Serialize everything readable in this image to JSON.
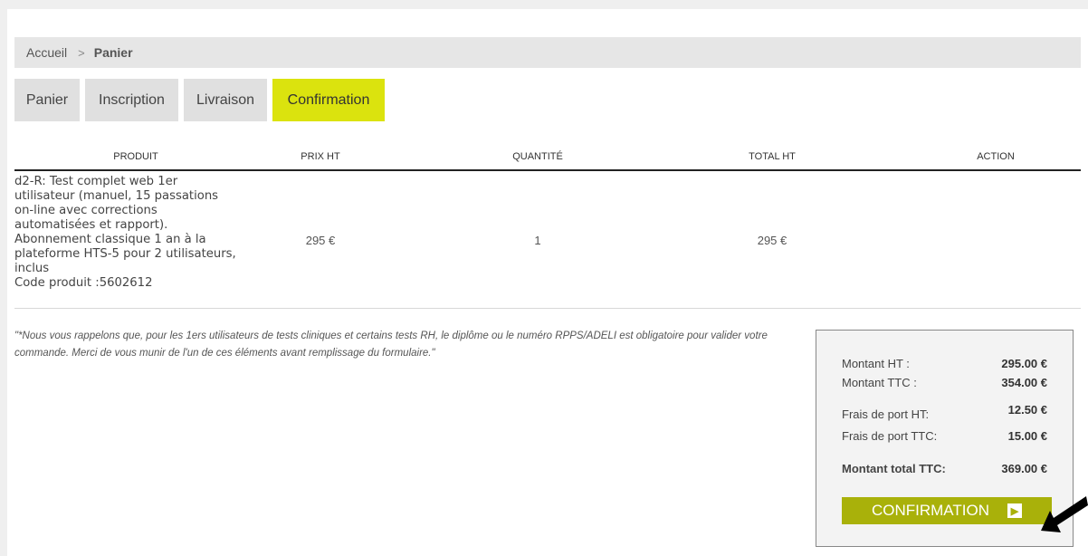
{
  "breadcrumb": {
    "home": "Accueil",
    "separator": ">",
    "current": "Panier"
  },
  "tabs": [
    {
      "label": "Panier",
      "active": false
    },
    {
      "label": "Inscription",
      "active": false
    },
    {
      "label": "Livraison",
      "active": false
    },
    {
      "label": "Confirmation",
      "active": true
    }
  ],
  "table": {
    "headers": {
      "product": "PRODUIT",
      "price": "PRIX HT",
      "quantity": "QUANTITÉ",
      "total": "TOTAL HT",
      "action": "ACTION"
    },
    "rows": [
      {
        "product": "d2-R: Test complet web 1er utilisateur (manuel, 15 passations on-line avec corrections automatisées et rapport). Abonnement classique 1 an à la plateforme HTS-5 pour 2 utilisateurs, inclus",
        "code": "Code produit :5602612",
        "price": "295 €",
        "quantity": "1",
        "total": "295 €"
      }
    ]
  },
  "note": "\"*Nous vous rappelons que, pour les 1ers utilisateurs de tests cliniques et certains tests RH, le diplôme ou le numéro RPPS/ADELI est obligatoire pour valider votre commande. Merci de vous munir de l'un de ces éléments avant remplissage du formulaire.\"",
  "summary": {
    "ht_label": "Montant HT :",
    "ht_value": "295.00 €",
    "ttc_label": "Montant TTC :",
    "ttc_value": "354.00 €",
    "shipping_ht_label": "Frais de port HT:",
    "shipping_ht_value": "12.50 €",
    "shipping_ttc_label": "Frais de port TTC:",
    "shipping_ttc_value": "15.00 €",
    "total_label": "Montant total TTC:",
    "total_value": "369.00 €",
    "confirm_label": "CONFIRMATION",
    "confirm_arrow": "▶"
  },
  "colors": {
    "active_tab": "#dbe30e",
    "confirm_button": "#a9b10a"
  },
  "icons": {
    "breadcrumb_separator": "chevron-right-icon",
    "confirm": "arrow-right-icon",
    "pointer": "black-arrow-pointer-icon"
  }
}
